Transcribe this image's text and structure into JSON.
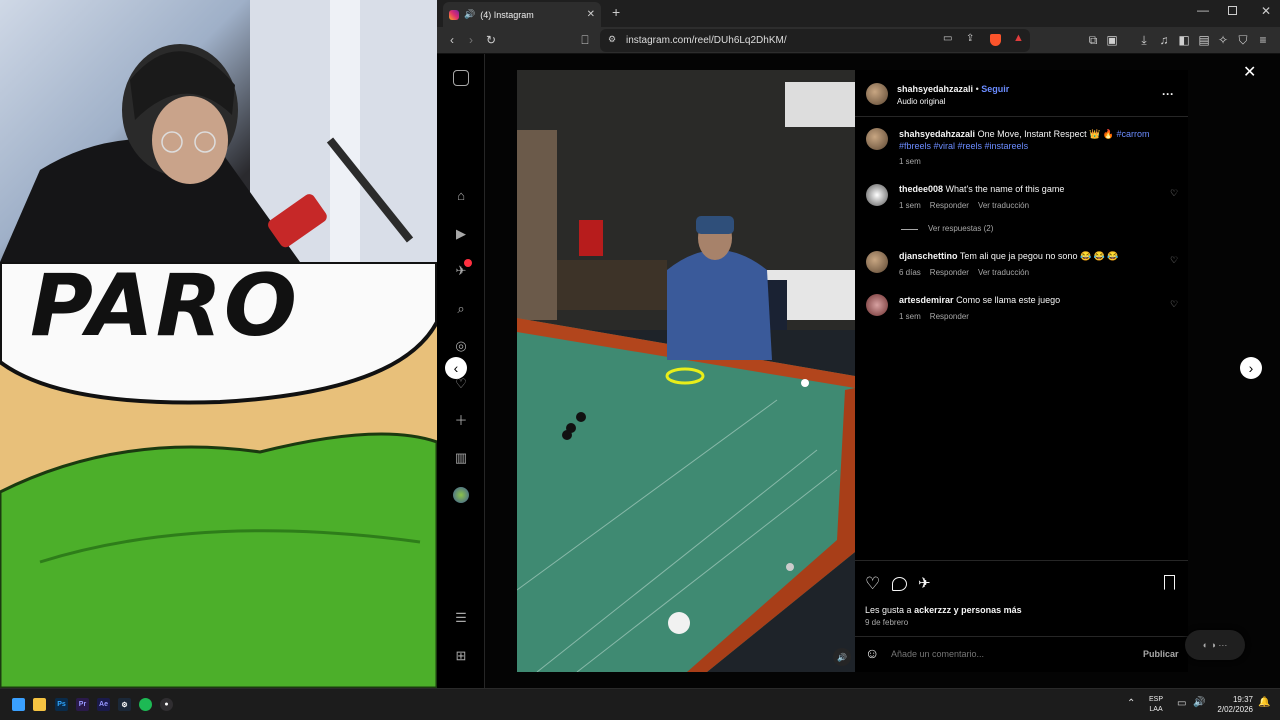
{
  "browser": {
    "tab_title": "(4) Instagram",
    "new_tab": "+",
    "address": "instagram.com/reel/DUh6Lq2DhKM/",
    "window_controls": [
      "minimize",
      "maximize",
      "close"
    ]
  },
  "instagram": {
    "close_icon": "✕",
    "post": {
      "author": "shahsyedahzazali",
      "separator": "•",
      "follow": "Seguir",
      "audio": "Audio original",
      "more": "···",
      "caption_author": "shahsyedahzazali",
      "caption_text": "One Move, Instant Respect 👑 🔥",
      "caption_tags_line1": "#carrom",
      "caption_tags_line2": "#fbreels #viral #reels #instareels",
      "caption_time": "1 sem"
    },
    "comments": [
      {
        "user": "thedee008",
        "text": "What's the name of this game",
        "time": "1 sem",
        "reply": "Responder",
        "translate": "Ver traducción"
      },
      {
        "user": "djanschettino",
        "text": "Tem ali que ja pegou no sono 😂 😂 😂",
        "time": "6 días",
        "reply": "Responder",
        "translate": "Ver traducción"
      },
      {
        "user": "artesdemirar",
        "text": "Como se llama este juego",
        "time": "1 sem",
        "reply": "Responder"
      }
    ],
    "view_replies": "Ver respuestas (2)",
    "likes_text": "Les gusta a",
    "likes_user": "ackerzzz",
    "likes_suffix": "y personas más",
    "date": "9 de febrero",
    "comment_placeholder": "Añade un comentario...",
    "publish": "Publicar"
  },
  "stream_overlay": {
    "meme_text": "PARO"
  },
  "taskbar": {
    "lang_top": "ESP",
    "lang_bottom": "LAA",
    "time": "19:37",
    "date": "2/02/2026"
  },
  "colors": {
    "accent_link": "#6b8cff",
    "ig_bg": "#000000",
    "table_felt": "#3f8a72",
    "table_wood": "#b2451c"
  }
}
